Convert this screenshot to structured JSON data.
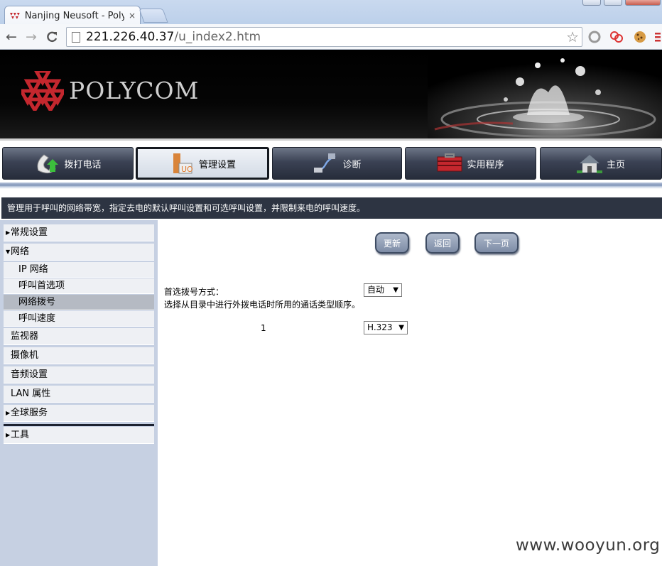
{
  "browser": {
    "tab_title": "Nanjing Neusoft - Polyc",
    "tab_close": "×",
    "url_host": "221.226.40.37",
    "url_path": "/u_index2.htm",
    "back_glyph": "←",
    "forward_glyph": "→",
    "reload_glyph": "C",
    "star_glyph": "☆"
  },
  "banner": {
    "brand": "POLYCOM"
  },
  "main_tabs": [
    {
      "label": "拨打电话",
      "icon": "phone-icon"
    },
    {
      "label": "管理设置",
      "icon": "admin-icon"
    },
    {
      "label": "诊断",
      "icon": "diagnostics-icon"
    },
    {
      "label": "实用程序",
      "icon": "toolbox-icon"
    },
    {
      "label": "主页",
      "icon": "home-icon"
    }
  ],
  "description": "管理用于呼叫的网络带宽，指定去电的默认呼叫设置和可选呼叫设置，并限制来电的呼叫速度。",
  "sidebar": {
    "items": [
      {
        "label": "常规设置"
      },
      {
        "label": "网络"
      },
      {
        "label": "IP 网络"
      },
      {
        "label": "呼叫首选项"
      },
      {
        "label": "网络拨号"
      },
      {
        "label": "呼叫速度"
      },
      {
        "label": "监视器"
      },
      {
        "label": "摄像机"
      },
      {
        "label": "音频设置"
      },
      {
        "label": "LAN 属性"
      },
      {
        "label": "全球服务"
      },
      {
        "label": "工具"
      }
    ],
    "selected": "网络拨号"
  },
  "content": {
    "buttons": {
      "update": "更新",
      "back": "返回",
      "next": "下一页"
    },
    "preferred_dial_label": "首选拨号方式：",
    "preferred_dial_value": "自动",
    "preferred_dial_desc": "选择从目录中进行外拨电话时所用的通话类型顺序。",
    "order_index": "1",
    "order_value": "H.323",
    "dropdown_glyph": "▼"
  },
  "watermark": "www.wooyun.org",
  "colors": {
    "nav_dark": "#2d3442",
    "sidebar_bg": "#c6d0e2",
    "brand_red": "#c4272e"
  }
}
